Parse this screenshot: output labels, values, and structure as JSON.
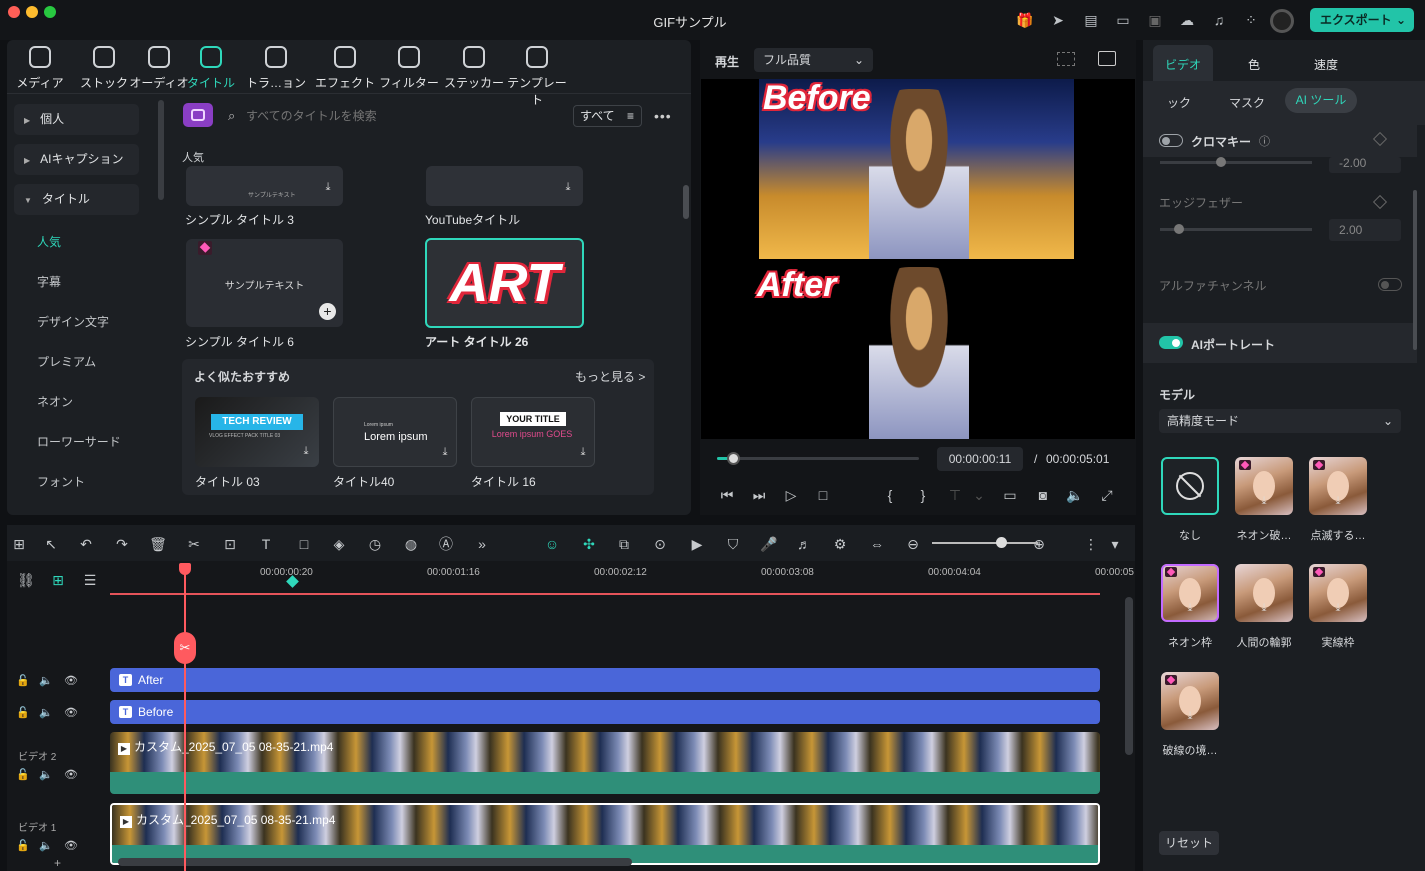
{
  "app": {
    "title": "GIFサンプル",
    "export_label": "エクスポート"
  },
  "media_tabs": [
    {
      "label": "メディア",
      "icon": "media-icon"
    },
    {
      "label": "ストック",
      "icon": "stock-icon"
    },
    {
      "label": "オーディオ",
      "icon": "audio-icon"
    },
    {
      "label": "タイトル",
      "icon": "title-icon"
    },
    {
      "label": "トラ…ョン",
      "icon": "transition-icon"
    },
    {
      "label": "エフェクト",
      "icon": "effect-icon"
    },
    {
      "label": "フィルター",
      "icon": "filter-icon"
    },
    {
      "label": "ステッカー",
      "icon": "sticker-icon"
    },
    {
      "label": "テンプレート",
      "icon": "template-icon"
    }
  ],
  "sidebar": {
    "categories": [
      "個人",
      "AIキャプション",
      "タイトル"
    ],
    "subitems": [
      "人気",
      "字幕",
      "デザイン文字",
      "プレミアム",
      "ネオン",
      "ローワーサード",
      "フォント"
    ]
  },
  "search": {
    "placeholder": "すべてのタイトルを検索",
    "filter_label": "すべて"
  },
  "section_label": "人気",
  "titles": [
    {
      "label": "シンプル タイトル 3",
      "preview": "サンプルテキスト"
    },
    {
      "label": "YouTubeタイトル",
      "preview": ""
    },
    {
      "label": "シンプル タイトル 6",
      "preview": "サンプルテキスト"
    },
    {
      "label": "アート タイトル 26",
      "preview": "ART"
    }
  ],
  "recommend": {
    "heading": "よく似たおすすめ",
    "more": "もっと見る >",
    "items": [
      {
        "label": "タイトル 03",
        "preview": "TECH REVIEW",
        "sub": "VLOG EFFECT PACK TITLE 03"
      },
      {
        "label": "タイトル40",
        "preview": "Lorem ipsum",
        "sub": "Lorem ipsum"
      },
      {
        "label": "タイトル 16",
        "preview": "YOUR TITLE",
        "sub": "Lorem ipsum GOES"
      }
    ]
  },
  "preview": {
    "play_label": "再生",
    "quality": "フル品質",
    "top_caption": "Before",
    "bottom_caption": "After",
    "current_time": "00:00:00:11",
    "separator": "/",
    "total_time": "00:00:05:01",
    "progress": 0.08
  },
  "right_panel": {
    "tabs": [
      "ビデオ",
      "色",
      "速度"
    ],
    "subtabs": [
      "ック",
      "マスク",
      "AI ツール"
    ],
    "chroma_label": "クロマキー",
    "chroma_value": "-2.00",
    "edge_label": "エッジフェザー",
    "edge_value": "2.00",
    "alpha_label": "アルファチャンネル",
    "portrait_label": "AIポートレート",
    "model_label": "モデル",
    "model_value": "高精度モード",
    "effects": [
      {
        "label": "なし"
      },
      {
        "label": "ネオン破…"
      },
      {
        "label": "点滅する…"
      },
      {
        "label": "ネオン枠"
      },
      {
        "label": "人間の輪郭"
      },
      {
        "label": "実線枠"
      },
      {
        "label": "破線の境…"
      }
    ],
    "reset_label": "リセット"
  },
  "timeline": {
    "ruler": [
      "00:00:00:20",
      "00:00:01:16",
      "00:00:02:12",
      "00:00:03:08",
      "00:00:04:04",
      "00:00:05"
    ],
    "tracks": [
      {
        "type": "title",
        "clip": "After"
      },
      {
        "type": "title",
        "clip": "Before"
      },
      {
        "type": "video",
        "name": "ビデオ 2",
        "clip": "カスタム_2025_07_05 08-35-21.mp4"
      },
      {
        "type": "video",
        "name": "ビデオ 1",
        "clip": "カスタム_2025_07_05 08-35-21.mp4"
      }
    ]
  },
  "colors": {
    "accent": "#22c4a8",
    "title_clip": "#4a66d9",
    "playhead": "#ff5a5f"
  }
}
